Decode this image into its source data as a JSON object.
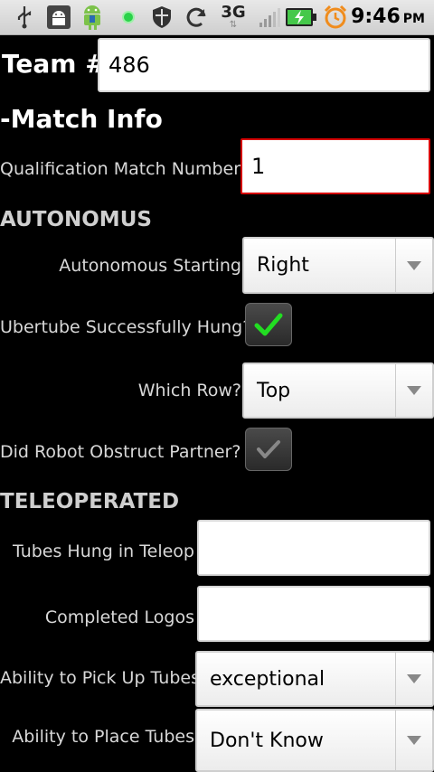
{
  "status_bar": {
    "time": "9:46",
    "ampm": "PM",
    "network": "3G",
    "icons": [
      "usb-icon",
      "android-debug-icon",
      "android-app-icon",
      "green-dot-icon",
      "shield-icon",
      "sync-icon",
      "3g-icon",
      "signal-icon",
      "battery-charging-icon",
      "alarm-clock-icon"
    ]
  },
  "team": {
    "label": "Team #",
    "value": "486"
  },
  "match_info": {
    "heading": "-Match Info",
    "qual_label": "Qualification Match Number",
    "qual_value": "1"
  },
  "autonomous": {
    "heading": "AUTONOMUS",
    "starting_label": "Autonomous Starting",
    "starting_value": "Right",
    "ubertube_label": "Ubertube Successfully Hung?",
    "ubertube_checked": true,
    "row_label": "Which Row?",
    "row_value": "Top",
    "obstruct_label": "Did Robot Obstruct Partner?",
    "obstruct_checked": false
  },
  "teleoperated": {
    "heading": "TELEOPERATED",
    "tubes_label": "Tubes Hung in Teleop",
    "tubes_value": "",
    "logos_label": "Completed Logos",
    "logos_value": "",
    "pickup_label": "Ability to Pick Up Tubes",
    "pickup_value": "exceptional",
    "place_label": "Ability to Place Tubes",
    "place_value": "Don't Know"
  },
  "colors": {
    "focus_border": "#d60000",
    "check_on": "#22dd22",
    "check_off": "#888888"
  }
}
